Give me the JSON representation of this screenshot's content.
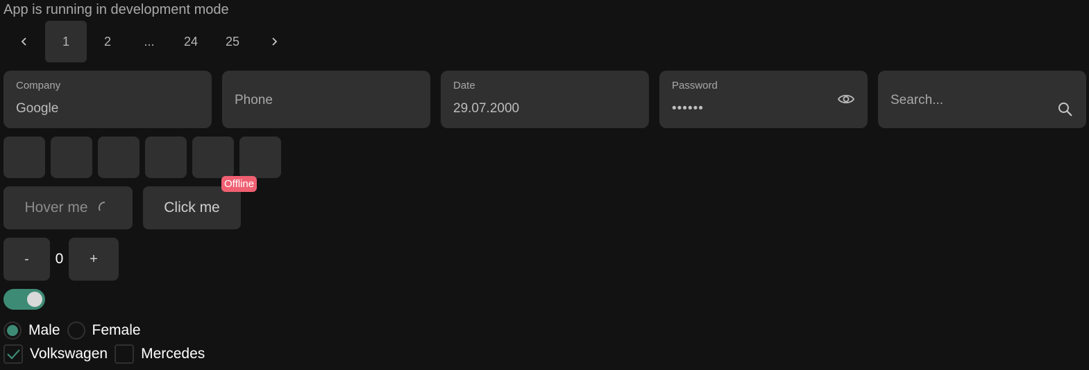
{
  "banner": {
    "text": "App is running in development mode"
  },
  "pagination": {
    "prev_icon": "chevron-left-icon",
    "next_icon": "chevron-right-icon",
    "pages": [
      "1",
      "2",
      "...",
      "24",
      "25"
    ],
    "active_page": "1"
  },
  "fields": {
    "company": {
      "label": "Company",
      "value": "Google"
    },
    "phone": {
      "placeholder": "Phone"
    },
    "date": {
      "label": "Date",
      "value": "29.07.2000"
    },
    "password": {
      "label": "Password",
      "value": "••••••",
      "icon": "eye-icon"
    },
    "search": {
      "placeholder": "Search...",
      "icon": "search-icon"
    }
  },
  "code_input": {
    "cells": [
      "",
      "",
      "",
      "",
      "",
      ""
    ]
  },
  "buttons": {
    "hover_label": "Hover me",
    "click_label": "Click me",
    "offline_badge": "Offline"
  },
  "stepper": {
    "minus_label": "-",
    "value": "0",
    "plus_label": "+"
  },
  "toggle": {
    "on": true
  },
  "gender": {
    "options": [
      "Male",
      "Female"
    ],
    "selected": "Male"
  },
  "cars": {
    "options": [
      "Volkswagen",
      "Mercedes"
    ],
    "checked": [
      "Volkswagen"
    ]
  },
  "colors": {
    "background": "#121212",
    "surface": "#303030",
    "accent": "#3e8b75",
    "badge": "#f06072"
  }
}
